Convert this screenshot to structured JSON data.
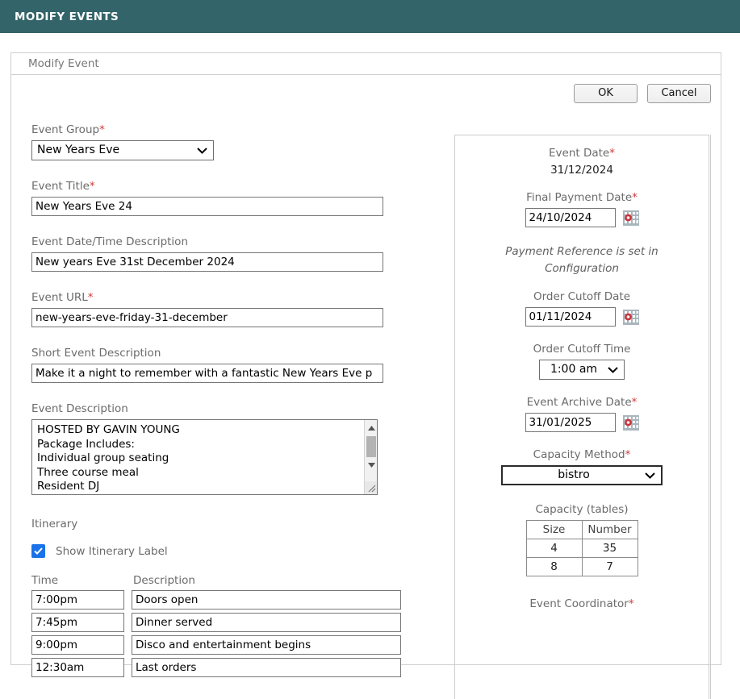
{
  "topbar": {
    "title": "MODIFY EVENTS",
    "bg": "#33646a"
  },
  "panel": {
    "title": "Modify Event"
  },
  "actions": {
    "ok_label": "OK",
    "cancel_label": "Cancel"
  },
  "left": {
    "event_group": {
      "label": "Event Group",
      "required": true,
      "value": "New Years Eve"
    },
    "event_title": {
      "label": "Event Title",
      "required": true,
      "value": "New Years Eve 24"
    },
    "event_datetime_desc": {
      "label": "Event Date/Time Description",
      "required": false,
      "value": "New years Eve 31st December 2024"
    },
    "event_url": {
      "label": "Event URL",
      "required": true,
      "value": "new-years-eve-friday-31-december"
    },
    "short_desc": {
      "label": "Short Event Description",
      "required": false,
      "value": "Make it a night to remember with a fantastic New Years Eve p"
    },
    "event_desc": {
      "label": "Event Description",
      "value": "HOSTED BY GAVIN YOUNG\nPackage Includes:\nIndividual group seating\nThree course meal\nResident DJ"
    },
    "itinerary": {
      "section_label": "Itinerary",
      "show_label_checkbox": {
        "label": "Show Itinerary Label",
        "checked": true
      },
      "col_time": "Time",
      "col_description": "Description",
      "rows": [
        {
          "time": "7:00pm",
          "description": "Doors open"
        },
        {
          "time": "7:45pm",
          "description": "Dinner served"
        },
        {
          "time": "9:00pm",
          "description": "Disco and entertainment begins"
        },
        {
          "time": "12:30am",
          "description": "Last orders"
        }
      ]
    }
  },
  "right": {
    "event_date": {
      "label": "Event Date",
      "required": true,
      "value": "31/12/2024"
    },
    "final_payment_date": {
      "label": "Final Payment Date",
      "required": true,
      "value": "24/10/2024"
    },
    "payment_reference_note": "Payment Reference is set in Configuration",
    "order_cutoff_date": {
      "label": "Order Cutoff Date",
      "required": false,
      "value": "01/11/2024"
    },
    "order_cutoff_time": {
      "label": "Order Cutoff Time",
      "required": false,
      "value": "1:00 am"
    },
    "event_archive_date": {
      "label": "Event Archive Date",
      "required": true,
      "value": "31/01/2025"
    },
    "capacity_method": {
      "label": "Capacity Method",
      "required": true,
      "value": "bistro"
    },
    "capacity": {
      "label": "Capacity (tables)",
      "headers": [
        "Size",
        "Number"
      ],
      "rows": [
        [
          "4",
          "35"
        ],
        [
          "8",
          "7"
        ]
      ]
    },
    "event_coordinator": {
      "label": "Event Coordinator",
      "required": true
    }
  },
  "icons": {
    "calendar": "calendar-icon",
    "chevron": "chevron-down-icon",
    "checkmark": "check-icon"
  },
  "colors": {
    "accent": "#33646a",
    "required": "#cc3b3b",
    "checkbox": "#1a73e8"
  }
}
